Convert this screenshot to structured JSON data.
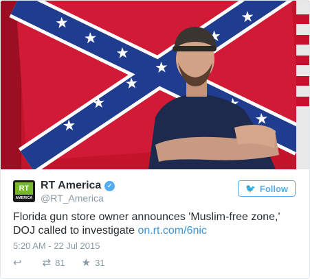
{
  "tweet": {
    "display_name": "RT America",
    "handle": "@RT_America",
    "follow_label": "Follow",
    "text": "Florida gun store owner announces 'Muslim-free zone,' DOJ called to investigate",
    "link": "on.rt.com/6nic",
    "timestamp": "5:20 AM - 22 Jul 2015",
    "retweet_count": "81",
    "favorite_count": "31",
    "avatar": {
      "logo": "RT",
      "label": "AMERICA"
    }
  },
  "colors": {
    "accent": "#55acee",
    "link": "#3b94d9",
    "text": "#292f33",
    "muted": "#8899a6",
    "rt_green": "#76b82a"
  },
  "icons": {
    "verified": "verified-badge-icon",
    "follow": "twitter-bird-icon",
    "reply": "reply-icon",
    "retweet": "retweet-icon",
    "favorite": "star-icon"
  }
}
